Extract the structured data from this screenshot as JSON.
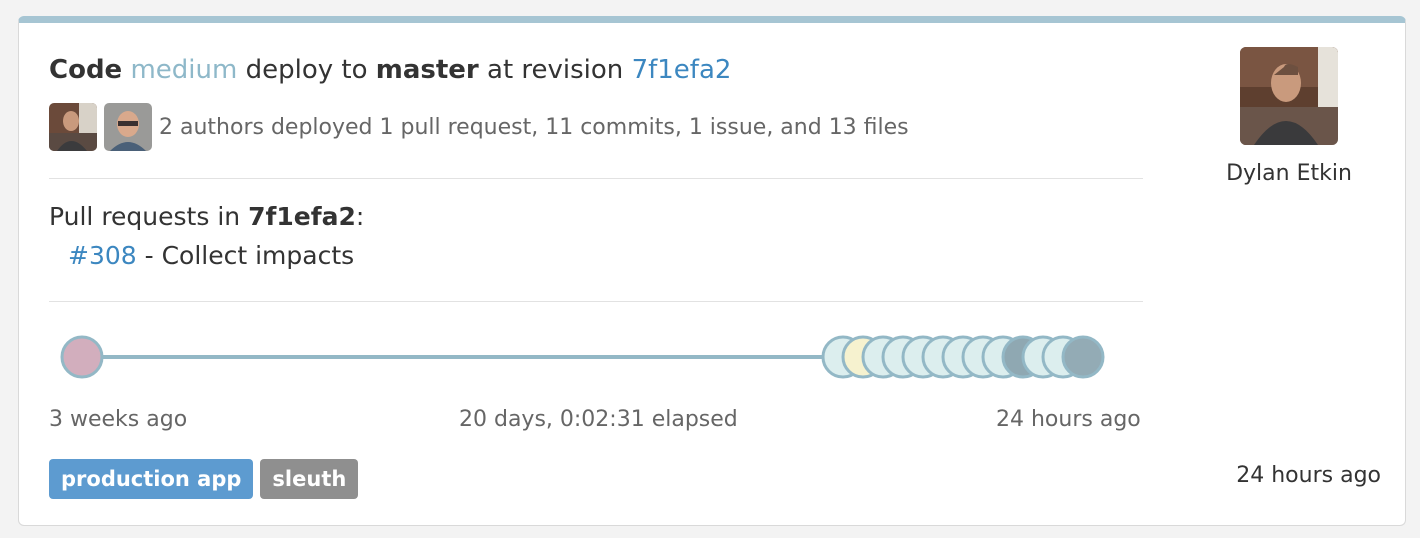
{
  "deploy": {
    "code_label": "Code",
    "environment": "medium",
    "deploy_to_label": "deploy to",
    "branch": "master",
    "at_revision_label": "at revision",
    "revision": "7f1efa2",
    "summary": "2 authors deployed 1 pull request, 11 commits, 1 issue, and 13 files"
  },
  "pull_requests": {
    "heading_prefix": "Pull requests in",
    "revision": "7f1efa2",
    "heading_suffix": ":",
    "items": [
      {
        "number": "#308",
        "separator": " - ",
        "title": "Collect impacts"
      }
    ]
  },
  "timeline": {
    "start_label": "3 weeks ago",
    "elapsed_label": "20 days, 0:02:31 elapsed",
    "end_label": "24 hours ago",
    "line_color": "#93b8c6",
    "first_commit_color": "#d2aebd",
    "commit_colors": [
      "#dceeee",
      "#f6f2cf",
      "#dceeee",
      "#dceeee",
      "#dceeee",
      "#dceeee",
      "#dceeee",
      "#dceeee",
      "#dceeee",
      "#8fa8b2",
      "#dceeee",
      "#dceeee",
      "#93abb5"
    ]
  },
  "tags": [
    {
      "label": "production app",
      "color": "#5d9bd0"
    },
    {
      "label": "sleuth",
      "color": "#8f8f8f"
    }
  ],
  "deployer": {
    "name": "Dylan Etkin"
  },
  "deployed_time": "24 hours ago"
}
